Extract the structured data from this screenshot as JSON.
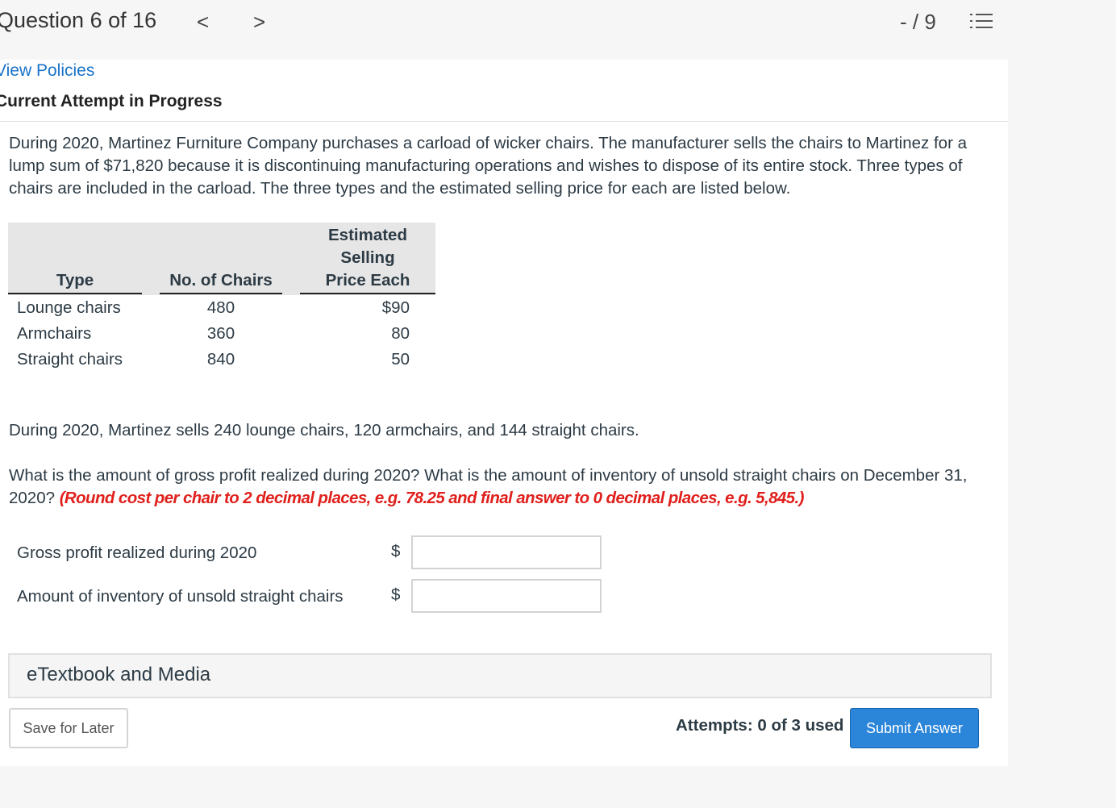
{
  "header": {
    "question_label": "Question 6 of 16",
    "prev_glyph": "<",
    "next_glyph": ">",
    "score": "- / 9",
    "list_icon": "numbered-list-icon"
  },
  "policies_link": "View Policies",
  "attempt_heading": "Current Attempt in Progress",
  "problem": {
    "paragraph1": "During 2020, Martinez Furniture Company purchases a carload of wicker chairs. The manufacturer sells the chairs to Martinez for a lump sum of $71,820 because it is discontinuing manufacturing operations and wishes to dispose of its entire stock. Three types of chairs are included in the carload. The three types and the estimated selling price for each are listed below.",
    "paragraph2": "During 2020, Martinez sells 240 lounge chairs, 120 armchairs, and 144 straight chairs.",
    "question_text": "What is the amount of gross profit realized during 2020? What is the amount of inventory of unsold straight chairs on December 31, 2020? ",
    "hint": "(Round cost per chair to 2 decimal places, e.g. 78.25 and final answer to 0 decimal places, e.g. 5,845.)"
  },
  "table": {
    "headers": {
      "type": "Type",
      "count": "No. of Chairs",
      "price_line1": "Estimated",
      "price_line2": "Selling",
      "price_line3": "Price Each"
    },
    "rows": [
      {
        "type": "Lounge chairs",
        "count": "480",
        "price": "$90"
      },
      {
        "type": "Armchairs",
        "count": "360",
        "price": "80"
      },
      {
        "type": "Straight chairs",
        "count": "840",
        "price": "50"
      }
    ]
  },
  "answers": [
    {
      "label": "Gross profit realized during 2020",
      "currency": "$",
      "value": "",
      "placeholder": ""
    },
    {
      "label": "Amount of inventory of unsold straight chairs",
      "currency": "$",
      "value": "",
      "placeholder": ""
    }
  ],
  "etextbook_label": "eTextbook and Media",
  "footer": {
    "save_label": "Save for Later",
    "attempts_text": "Attempts: 0 of 3 used",
    "submit_label": "Submit Answer"
  },
  "colors": {
    "link": "#1a73c9",
    "hint": "#e0201c",
    "submit": "#2b86d9"
  }
}
